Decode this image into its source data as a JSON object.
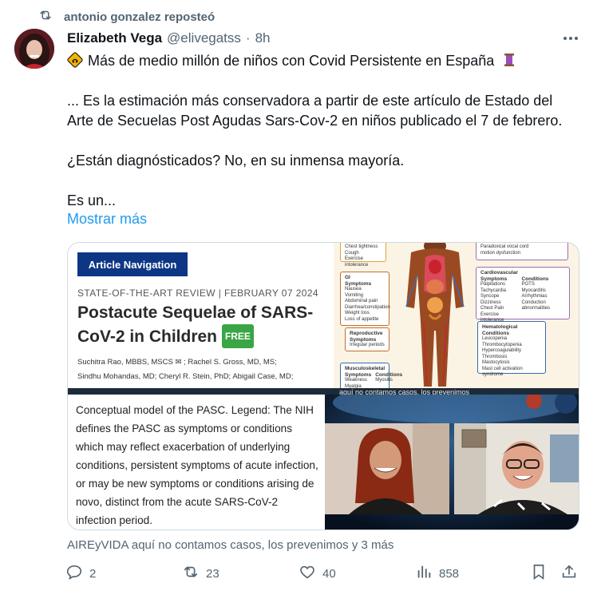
{
  "repost": {
    "text": "antonio gonzalez reposteó",
    "icon": "repost-icon"
  },
  "tweet": {
    "author_name": "Elizabeth Vega",
    "author_handle": "@elivegatss",
    "separator": "·",
    "time": "8h",
    "line1": "Más de medio millón de niños con Covid Persistente en España",
    "line2": "... Es la estimación más conservadora a partir de este artículo de Estado del",
    "line3": "Arte de Secuelas Post Agudas Sars-Cov-2 en niños publicado el 7 de febrero.",
    "line4": "¿Están diagnósticados? No, en su inmensa mayoría.",
    "line5": "Es un...",
    "show_more": "Mostrar más"
  },
  "media": {
    "article": {
      "nav": "Article Navigation",
      "kicker": "STATE-OF-THE-ART REVIEW  |  FEBRUARY 07 2024",
      "title": "Postacute Sequelae of SARS-CoV-2 in Children",
      "badge": "FREE",
      "authors1": "Suchitra Rao, MBBS, MSCS ✉ ; Rachel S. Gross, MD, MS;",
      "authors2": "Sindhu Mohandas, MD; Cheryl R. Stein, PhD; Abigail Case, MD;"
    },
    "infographic": {
      "box_top": "Chest tightness\nCough\nExercise intolerance",
      "box_top_right": "Paradoxical vocal cord\nmotion dysfunction",
      "gi_title": "GI",
      "gi_sub": "Symptoms",
      "gi_items": "Nausea\nVomiting\nAbdominal pain\nDiarrhea/constipation\nWeight loss\nLoss of appetite",
      "cardio_title": "Cardiovascular",
      "cardio_sub1": "Symptoms",
      "cardio_items1": "Palpitations\nTachycardia\nSyncope\nDizziness\nChest Pain\nExercise intolerance",
      "cardio_sub2": "Conditions",
      "cardio_items2": "POTS\nMyocarditis\nArrhythmias\nConduction abnormalities",
      "repro_title": "Reproductive",
      "repro_sub": "Symptoms",
      "repro_items": "Irregular periods",
      "hema_title": "Hematological",
      "hema_sub": "Conditions",
      "hema_items": "Leucopenia\nThrombocytopenia\nHypercoagulability\nThrombosis\nMastocytosis\nMast cell activation\nsyndrome",
      "musc_title": "Musculoskeletal",
      "musc_sub1": "Symptoms",
      "musc_items1": "Weakness\nMyalgia",
      "musc_sub2": "Conditions",
      "musc_items2": "Myositis"
    },
    "banner_caption": "aquí no contamos casos, los prevenimos",
    "caption": "Conceptual model of the PASC. Legend: The NIH defines the PASC as symptoms or conditions which may reflect exacerbation of underlying conditions, persistent symptoms of acute infection, or may be new symptoms or conditions arising de novo, distinct from the acute SARS-CoV-2 infection period."
  },
  "source_line": "AIREyVIDA aquí no contamos casos, los prevenimos y 3 más",
  "actions": {
    "replies": "2",
    "reposts": "23",
    "likes": "40",
    "views": "858"
  },
  "colors": {
    "link": "#1d9bf0",
    "muted": "#536471",
    "nav_bg": "#0d3685",
    "free_badge": "#3aa545"
  }
}
